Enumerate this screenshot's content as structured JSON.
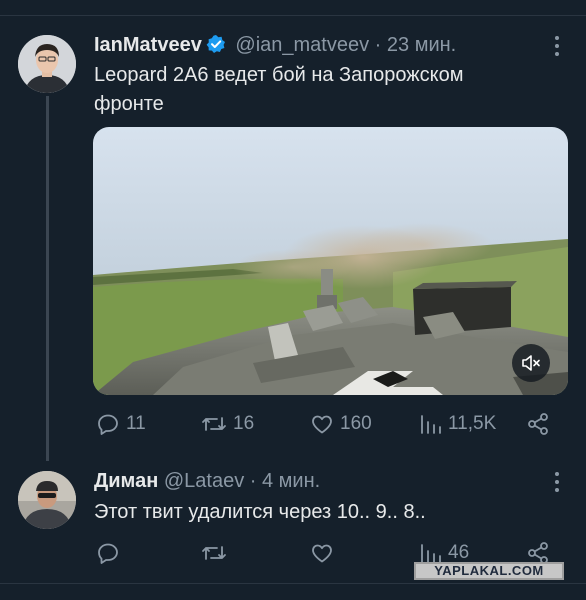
{
  "tweet1": {
    "name": "IanMatveev",
    "handle": "@ian_matveev",
    "time": "· 23 мин.",
    "text": "Leopard 2A6 ведет бой на Запорожском фронте",
    "stats": {
      "replies": "11",
      "retweets": "16",
      "likes": "160",
      "views": "11,5K"
    }
  },
  "tweet2": {
    "name": "Диман",
    "handle": "@Lataev",
    "time": "· 4 мин.",
    "text": "Этот твит удалится через 10.. 9.. 8..",
    "stats": {
      "views": "46"
    }
  },
  "watermark": "YAPLAKAL.COM",
  "colors": {
    "background": "#15202b",
    "text": "#e7e9ea",
    "secondary": "#8b98a5",
    "verified": "#1d9bf0"
  },
  "icons": {
    "verified": "verified-badge-icon",
    "more": "more-dots-icon",
    "mute": "volume-muted-icon",
    "reply": "reply-icon",
    "retweet": "retweet-icon",
    "like": "heart-icon",
    "views": "views-icon",
    "share": "share-icon"
  }
}
